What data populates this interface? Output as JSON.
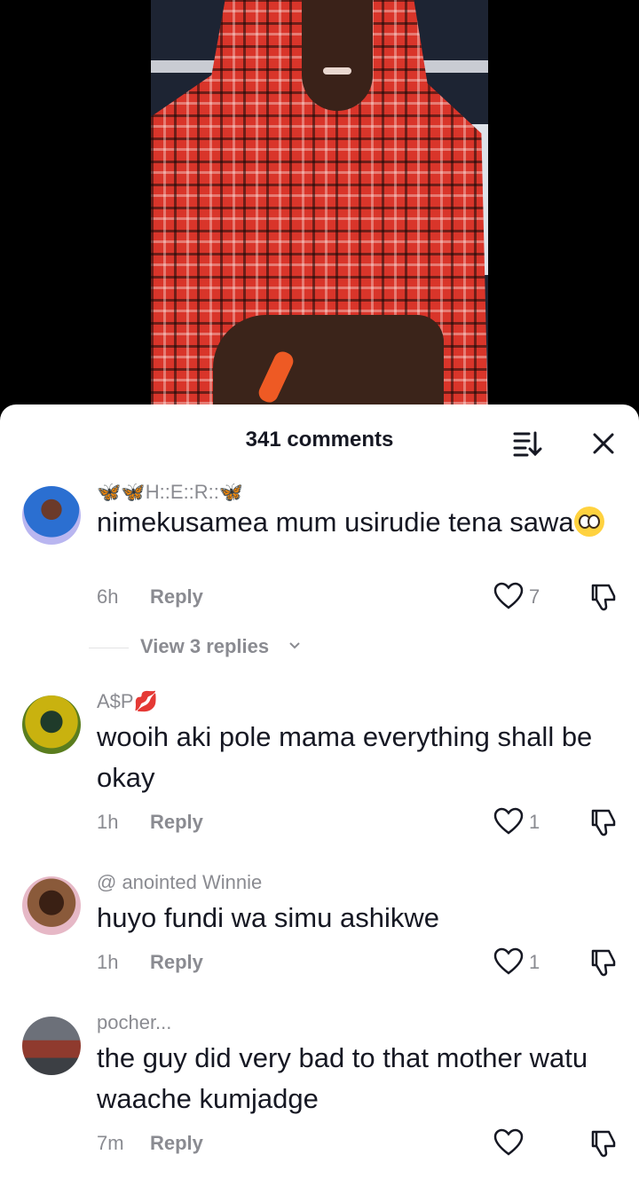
{
  "sheet": {
    "title": "341 comments"
  },
  "comments": [
    {
      "username": "🦋🦋H::E::R::🦋",
      "text": "nimekusamea mum usirudie tena sawa",
      "emoji": "pleading-face",
      "time": "6h",
      "reply": "Reply",
      "likes": "7",
      "view_replies": "View 3 replies"
    },
    {
      "username": "A$P💋",
      "text": "wooih aki pole mama everything shall be okay",
      "time": "1h",
      "reply": "Reply",
      "likes": "1"
    },
    {
      "username": "@ anointed Winnie",
      "text": "huyo fundi wa simu ashikwe",
      "time": "1h",
      "reply": "Reply",
      "likes": "1"
    },
    {
      "username": "pocher...",
      "text": "the guy did very bad to that mother watu waache kumjadge",
      "time": "7m",
      "reply": "Reply",
      "likes": ""
    }
  ],
  "colors": {
    "accent_text": "#161823",
    "muted": "#8a8b91"
  }
}
